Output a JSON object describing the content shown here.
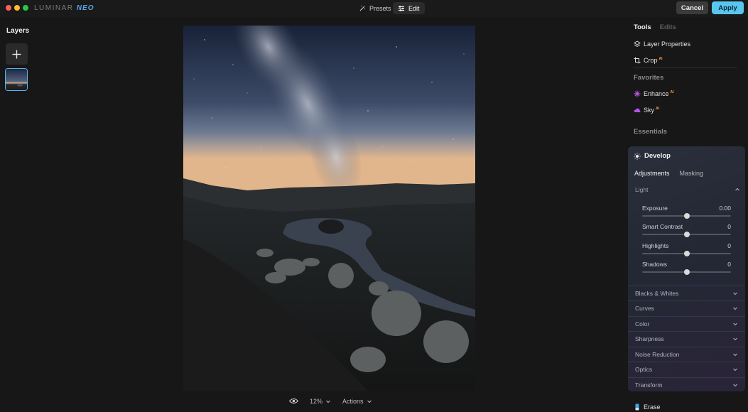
{
  "app": {
    "logo_main": "LUMINAR",
    "logo_accent": "NEO"
  },
  "top_bar": {
    "presets_label": "Presets",
    "edit_label": "Edit",
    "cancel_label": "Cancel",
    "apply_label": "Apply"
  },
  "layers": {
    "title": "Layers"
  },
  "bottom_bar": {
    "zoom": "12%",
    "actions_label": "Actions"
  },
  "right_panel": {
    "tabs": [
      "Tools",
      "Edits"
    ],
    "tools": {
      "layer_properties": "Layer Properties",
      "crop": "Crop",
      "crop_badge": "AI"
    },
    "favorites": {
      "title": "Favorites",
      "enhance": "Enhance",
      "enhance_badge": "AI",
      "sky": "Sky",
      "sky_badge": "AI"
    },
    "essentials_title": "Essentials",
    "develop": {
      "title": "Develop",
      "tabs": [
        "Adjustments",
        "Masking"
      ],
      "light_title": "Light",
      "sliders": [
        {
          "label": "Exposure",
          "value": "0.00",
          "level": 0.5
        },
        {
          "label": "Smart Contrast",
          "value": "0",
          "level": 0.5
        },
        {
          "label": "Highlights",
          "value": "0",
          "level": 0.5
        },
        {
          "label": "Shadows",
          "value": "0",
          "level": 0.5
        }
      ],
      "sections": [
        "Blacks & Whites",
        "Curves",
        "Color",
        "Sharpness",
        "Noise Reduction",
        "Optics",
        "Transform"
      ]
    },
    "erase_label": "Erase"
  },
  "colors": {
    "accent": "#58c7ef",
    "ai_badge": "#ff9b3d",
    "background": "#171717"
  }
}
